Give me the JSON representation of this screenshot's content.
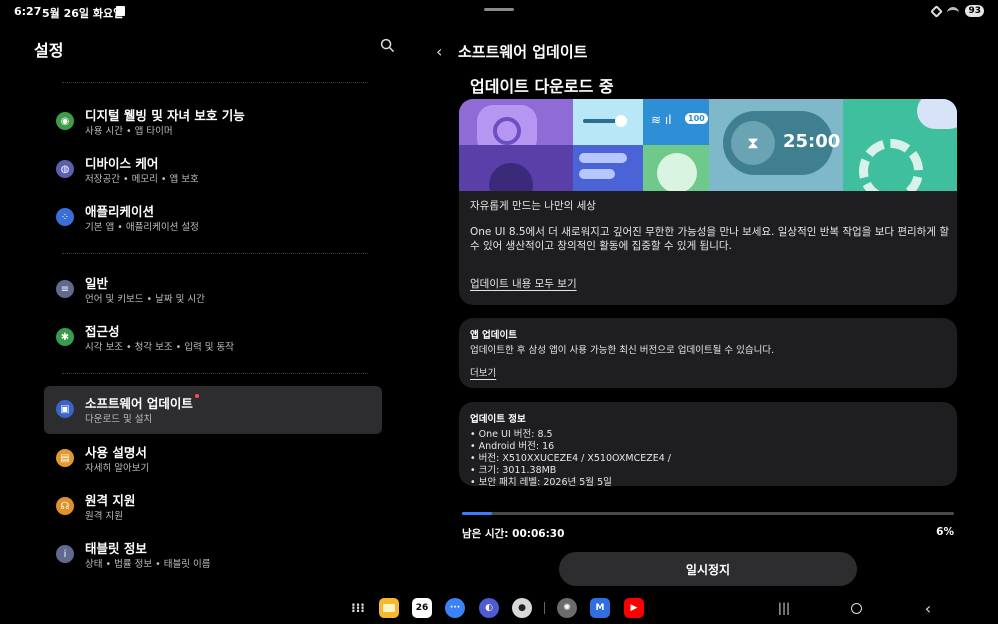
{
  "status_bar": {
    "time": "6:27",
    "date": "5월 26일 화요일",
    "battery": "93"
  },
  "left_pane": {
    "title": "설정",
    "items": [
      {
        "title": "디지털 웰빙 및 자녀 보호 기능",
        "subtitle": "사용 시간 • 앱 타이머",
        "icon": "digital-wellbeing-icon",
        "color": "#3f9c4a"
      },
      {
        "title": "디바이스 케어",
        "subtitle": "저장공간 • 메모리 • 앱 보호",
        "icon": "device-care-icon",
        "color": "#5b5fb0"
      },
      {
        "title": "애플리케이션",
        "subtitle": "기본 앱 • 애플리케이션 설정",
        "icon": "apps-icon",
        "color": "#3b6fd8"
      },
      {
        "title": "일반",
        "subtitle": "언어 및 키보드 • 날짜 및 시간",
        "icon": "general-icon",
        "color": "#5f6a8e"
      },
      {
        "title": "접근성",
        "subtitle": "시각 보조 • 청각 보조 • 입력 및 동작",
        "icon": "accessibility-icon",
        "color": "#3a9b4d"
      },
      {
        "title": "소프트웨어 업데이트",
        "subtitle": "다운로드 및 설치",
        "icon": "software-update-icon",
        "color": "#3b63c8"
      },
      {
        "title": "사용 설명서",
        "subtitle": "자세히 알아보기",
        "icon": "manual-icon",
        "color": "#e09a2d"
      },
      {
        "title": "원격 지원",
        "subtitle": "원격 지원",
        "icon": "remote-support-icon",
        "color": "#e0912a"
      },
      {
        "title": "태블릿 정보",
        "subtitle": "상태 • 법률 정보 • 태블릿 이름",
        "icon": "tablet-info-icon",
        "color": "#5f6a8e"
      }
    ]
  },
  "right_pane": {
    "title": "소프트웨어 업데이트",
    "download_title": "업데이트 다운로드 중",
    "banner": {
      "wifi_badge": "100",
      "timer": "25:00"
    },
    "feature_card": {
      "headline": "자유롭게 만드는 나만의 세상",
      "body": "One UI 8.5에서 더 새로워지고 깊어진 무한한 가능성을 만나 보세요. 일상적인 반복 작업을 보다 편리하게 할 수 있어 생산적이고 창의적인 활동에 집중할 수 있게 됩니다.",
      "link": "업데이트 내용 모두 보기"
    },
    "app_update_card": {
      "title": "앱 업데이트",
      "body": "업데이트한 후 삼성 앱이 사용 가능한 최신 버전으로 업데이트될 수 있습니다.",
      "link": "더보기"
    },
    "info_card": {
      "title": "업데이트 정보",
      "lines": [
        "• One UI 버전: 8.5",
        "• Android 버전: 16",
        "• 버전: X510XXUCEZE4 / X510OXMCEZE4 /",
        "• 크기: 3011.38MB",
        "• 보안 패치 레벨: 2026년 5월 5일"
      ]
    },
    "progress": {
      "remaining": "남은 시간: 00:06:30",
      "percent_label": "6%",
      "fraction": 0.06,
      "color": "#3d7bff"
    },
    "pause_button": "일시정지"
  },
  "taskbar": {
    "apps": [
      {
        "name": "app-drawer-icon"
      },
      {
        "name": "my-files-icon",
        "color": "#f5b82e"
      },
      {
        "name": "calendar-icon",
        "label": "26"
      },
      {
        "name": "messages-icon",
        "color": "#3b82f6"
      },
      {
        "name": "internet-icon",
        "color": "#4f5bd5"
      },
      {
        "name": "camera-icon",
        "color": "#d8d8d8"
      },
      {
        "name": "settings-icon",
        "color": "#6b6b6b"
      },
      {
        "name": "mail-icon",
        "color": "#2f6fe0"
      },
      {
        "name": "youtube-icon",
        "color": "#ff0000"
      }
    ]
  }
}
